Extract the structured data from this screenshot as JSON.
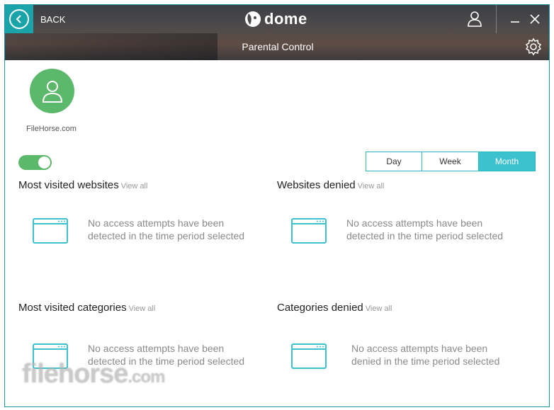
{
  "header": {
    "back_label": "BACK",
    "logo_text": "dome",
    "page_title": "Parental Control"
  },
  "profile": {
    "name": "FileHorse.com"
  },
  "protection_toggle": {
    "state": "on"
  },
  "period_tabs": [
    {
      "label": "Day",
      "active": false
    },
    {
      "label": "Week",
      "active": false
    },
    {
      "label": "Month",
      "active": true
    }
  ],
  "sections": {
    "most_visited_websites": {
      "title": "Most visited websites",
      "view_all": "View all",
      "empty_line1": "No access attempts have been",
      "empty_line2": "detected in the time period selected"
    },
    "websites_denied": {
      "title": "Websites denied",
      "view_all": "View all",
      "empty_line1": "No access attempts have been",
      "empty_line2": "detected in the time period selected"
    },
    "most_visited_categories": {
      "title": "Most visited categories",
      "view_all": "View all",
      "empty_line1": "No access attempts have been",
      "empty_line2": "detected in the time period selected"
    },
    "categories_denied": {
      "title": "Categories denied",
      "view_all": "View all",
      "empty_line1": "No access attempts have been",
      "empty_line2": "denied in the time period selected"
    }
  },
  "watermark": {
    "text": "filehorse",
    "suffix": ".com"
  },
  "colors": {
    "accent": "#3cc1ce",
    "back_button": "#1aa3a8",
    "avatar": "#5cb86a",
    "toggle_on": "#5cb86a"
  }
}
